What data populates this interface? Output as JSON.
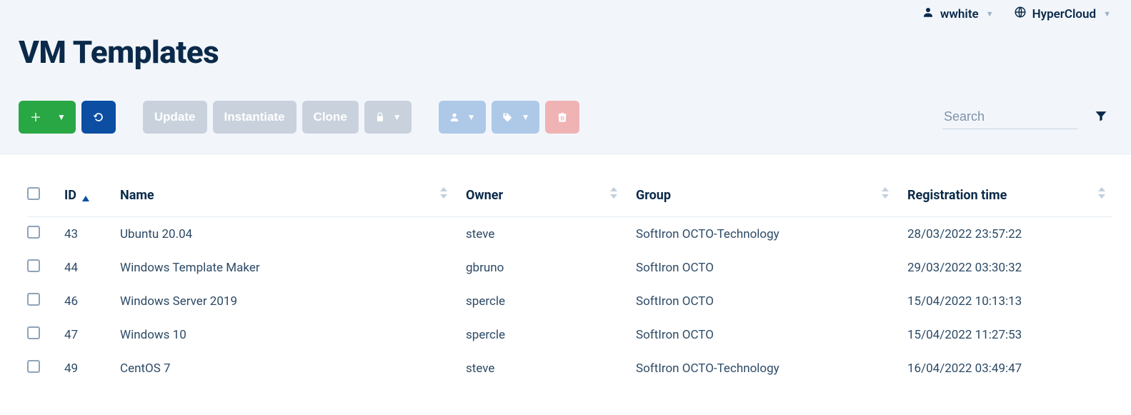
{
  "topbar": {
    "user": "wwhite",
    "tenant": "HyperCloud"
  },
  "page": {
    "title": "VM Templates"
  },
  "toolbar": {
    "update_label": "Update",
    "instantiate_label": "Instantiate",
    "clone_label": "Clone",
    "search_placeholder": "Search"
  },
  "table": {
    "columns": {
      "id": "ID",
      "name": "Name",
      "owner": "Owner",
      "group": "Group",
      "registration": "Registration time"
    },
    "rows": [
      {
        "id": "43",
        "name": "Ubuntu 20.04",
        "owner": "steve",
        "group": "SoftIron OCTO-Technology",
        "registration": "28/03/2022 23:57:22"
      },
      {
        "id": "44",
        "name": "Windows Template Maker",
        "owner": "gbruno",
        "group": "SoftIron OCTO",
        "registration": "29/03/2022 03:30:32"
      },
      {
        "id": "46",
        "name": "Windows Server 2019",
        "owner": "spercle",
        "group": "SoftIron OCTO",
        "registration": "15/04/2022 10:13:13"
      },
      {
        "id": "47",
        "name": "Windows 10",
        "owner": "spercle",
        "group": "SoftIron OCTO",
        "registration": "15/04/2022 11:27:53"
      },
      {
        "id": "49",
        "name": "CentOS 7",
        "owner": "steve",
        "group": "SoftIron OCTO-Technology",
        "registration": "16/04/2022 03:49:47"
      }
    ]
  }
}
